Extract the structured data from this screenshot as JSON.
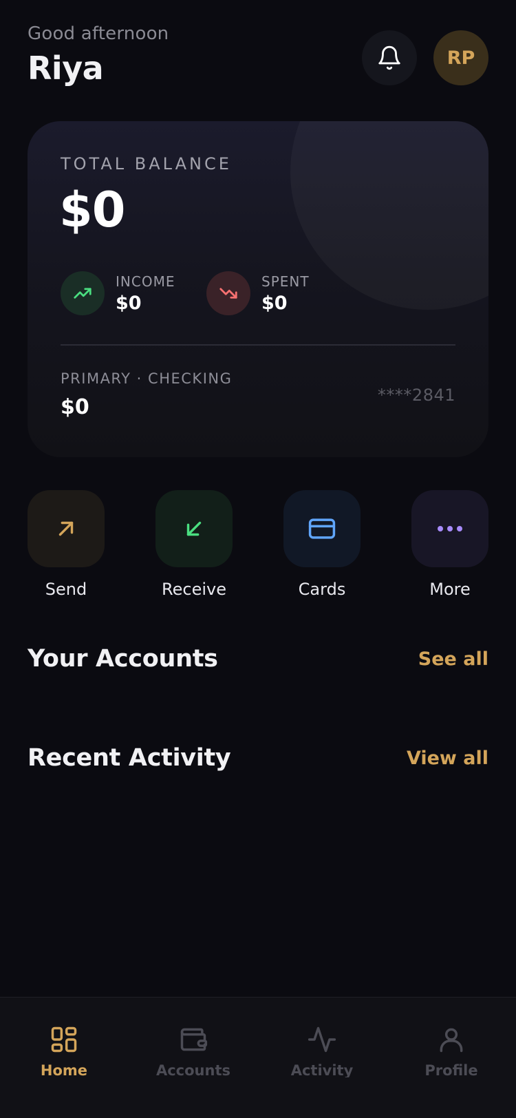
{
  "header": {
    "greeting": "Good afternoon",
    "name": "Riya",
    "avatar_initials": "RP"
  },
  "balance_card": {
    "label": "TOTAL BALANCE",
    "amount": "$0",
    "income_label": "INCOME",
    "income_value": "$0",
    "spent_label": "SPENT",
    "spent_value": "$0",
    "account_label": "PRIMARY · CHECKING",
    "account_balance": "$0",
    "account_number": "****2841"
  },
  "quick_actions": [
    {
      "label": "Send",
      "icon": "arrow-up-right-icon",
      "color": "#d4a55a"
    },
    {
      "label": "Receive",
      "icon": "arrow-down-left-icon",
      "color": "#4ade80"
    },
    {
      "label": "Cards",
      "icon": "credit-card-icon",
      "color": "#60a5fa"
    },
    {
      "label": "More",
      "icon": "more-dots-icon",
      "color": "#a78bfa"
    }
  ],
  "sections": {
    "accounts_title": "Your Accounts",
    "accounts_link": "See all",
    "activity_title": "Recent Activity",
    "activity_link": "View all"
  },
  "bottom_nav": [
    {
      "label": "Home",
      "icon": "grid-icon",
      "active": true
    },
    {
      "label": "Accounts",
      "icon": "wallet-icon",
      "active": false
    },
    {
      "label": "Activity",
      "icon": "pulse-icon",
      "active": false
    },
    {
      "label": "Profile",
      "icon": "user-icon",
      "active": false
    }
  ],
  "colors": {
    "background": "#0b0b11",
    "accent": "#d4a55a",
    "income": "#4ade80",
    "spent": "#f87171"
  }
}
